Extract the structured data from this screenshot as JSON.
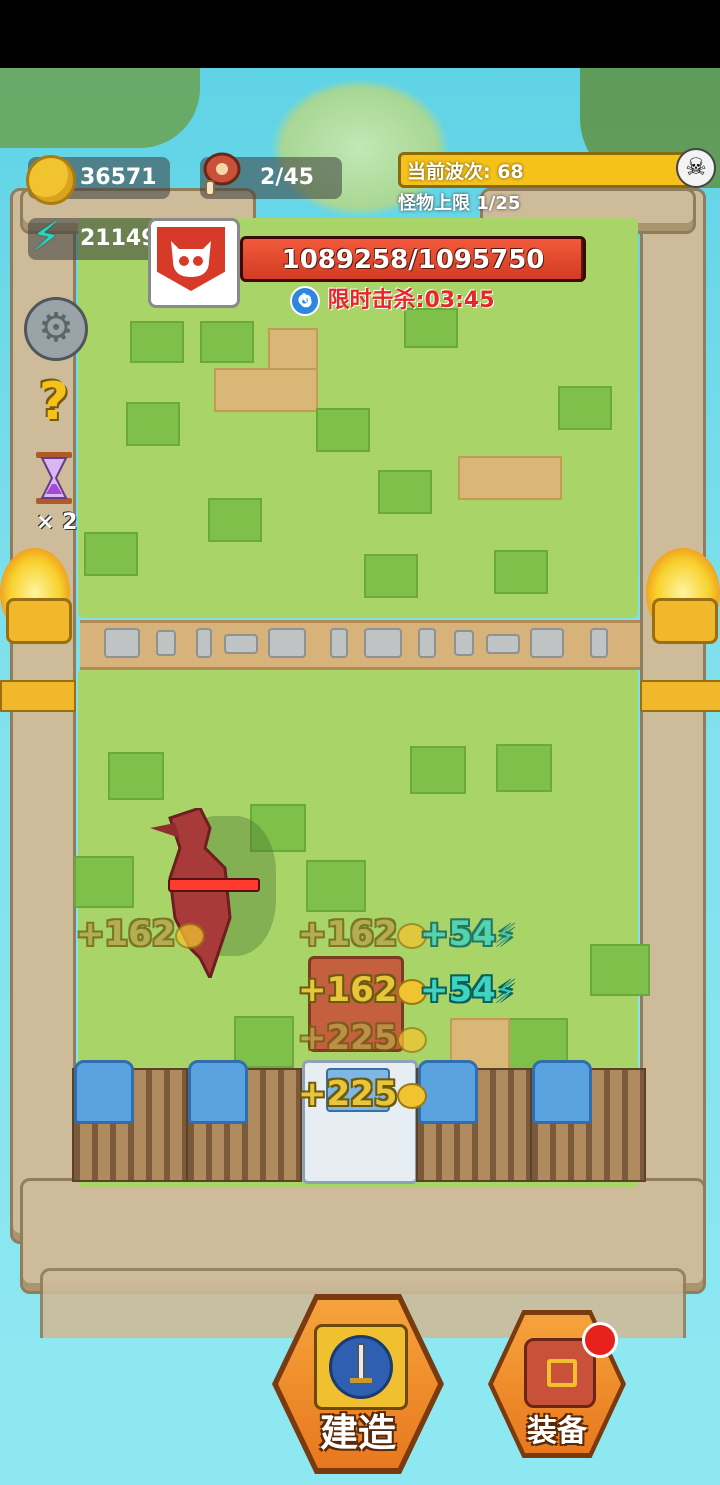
{
  "hud": {
    "coins": "36571",
    "meat": "2/45",
    "energy": "21149",
    "wave_label": "当前波次: 68",
    "monster_limit": "怪物上限 1/25",
    "speed_multiplier": "× 2"
  },
  "boss": {
    "hp_text": "1089258/1095750",
    "hp_fraction": 0.994,
    "timer_label": "限时击杀:03:45"
  },
  "floating_rewards": [
    {
      "text": "+162",
      "kind": "coin"
    },
    {
      "text": "+162",
      "kind": "coin"
    },
    {
      "text": "+54",
      "kind": "energy"
    },
    {
      "text": "+162",
      "kind": "coin"
    },
    {
      "text": "+54",
      "kind": "energy"
    },
    {
      "text": "+225",
      "kind": "coin"
    },
    {
      "text": "+225",
      "kind": "coin"
    }
  ],
  "buttons": {
    "build": "建造",
    "equip": "装备"
  },
  "icons": {
    "coin": "coin-icon",
    "meat": "meat-icon",
    "energy": "lightning-icon",
    "settings": "gear-icon",
    "help": "question-icon",
    "speed": "hourglass-icon",
    "boss": "boss-skull-icon",
    "wave": "skull-icon",
    "timer": "stopwatch-icon"
  },
  "colors": {
    "coin": "#f2c331",
    "energy": "#31c9c0",
    "boss_red": "#d83a2a",
    "wave_bar": "#f5c21b"
  }
}
